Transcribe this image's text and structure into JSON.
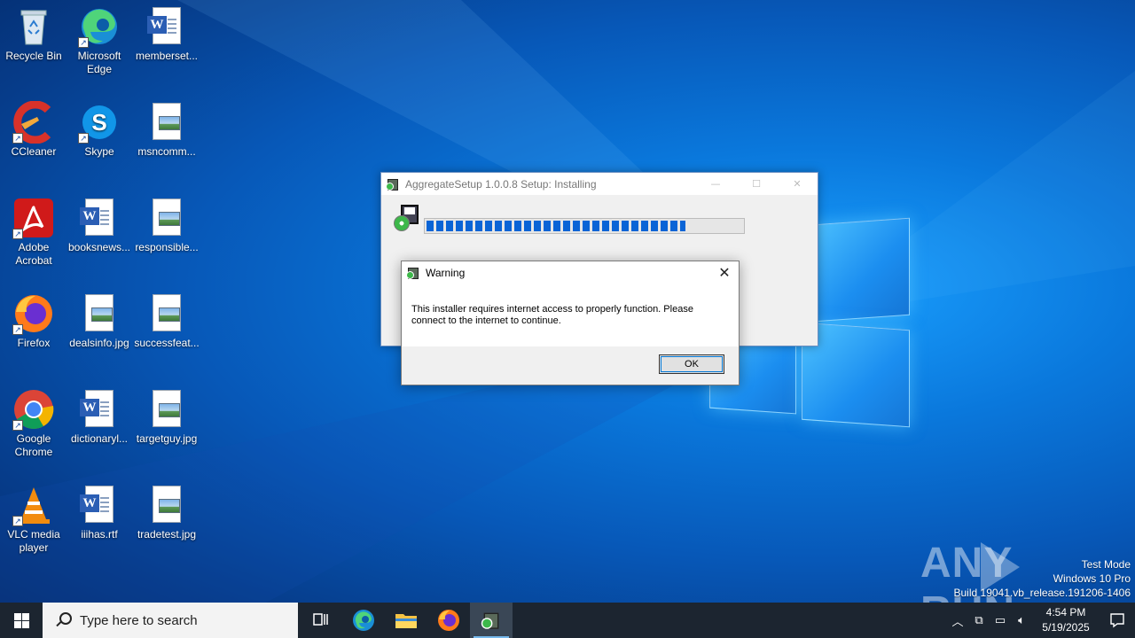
{
  "desktop": {
    "icons": [
      {
        "label": "Recycle Bin",
        "icon": "recycle-bin-icon"
      },
      {
        "label": "Microsoft Edge",
        "icon": "edge-icon"
      },
      {
        "label": "memberset...",
        "icon": "word-doc-icon"
      },
      {
        "label": "CCleaner",
        "icon": "ccleaner-icon"
      },
      {
        "label": "Skype",
        "icon": "skype-icon"
      },
      {
        "label": "msncomm...",
        "icon": "image-file-icon"
      },
      {
        "label": "Adobe Acrobat",
        "icon": "acrobat-icon"
      },
      {
        "label": "booksnews...",
        "icon": "word-doc-icon"
      },
      {
        "label": "responsible...",
        "icon": "image-file-icon"
      },
      {
        "label": "Firefox",
        "icon": "firefox-icon"
      },
      {
        "label": "dealsinfo.jpg",
        "icon": "image-file-icon"
      },
      {
        "label": "successfeat...",
        "icon": "image-file-icon"
      },
      {
        "label": "Google Chrome",
        "icon": "chrome-icon"
      },
      {
        "label": "dictionaryl...",
        "icon": "word-doc-icon"
      },
      {
        "label": "targetguy.jpg",
        "icon": "image-file-icon"
      },
      {
        "label": "VLC media player",
        "icon": "vlc-icon"
      },
      {
        "label": "iiihas.rtf",
        "icon": "word-doc-icon"
      },
      {
        "label": "tradetest.jpg",
        "icon": "image-file-icon"
      }
    ]
  },
  "installer": {
    "title": "AggregateSetup 1.0.0.8 Setup: Installing",
    "progress": 0.82,
    "minimize": "—",
    "maximize": "☐",
    "close": "✕"
  },
  "warning": {
    "title": "Warning",
    "message": "This installer requires internet access to properly function. Please connect to the internet to continue.",
    "ok_label": "OK",
    "close": "✕"
  },
  "watermark": {
    "left": "ANY",
    "right": "RUN"
  },
  "system_info": {
    "line1": "Test Mode",
    "line2": "Windows 10 Pro",
    "line3": "Build 19041.vb_release.191206-1406"
  },
  "taskbar": {
    "search_placeholder": "Type here to search",
    "time": "4:54 PM",
    "date": "5/19/2025"
  }
}
